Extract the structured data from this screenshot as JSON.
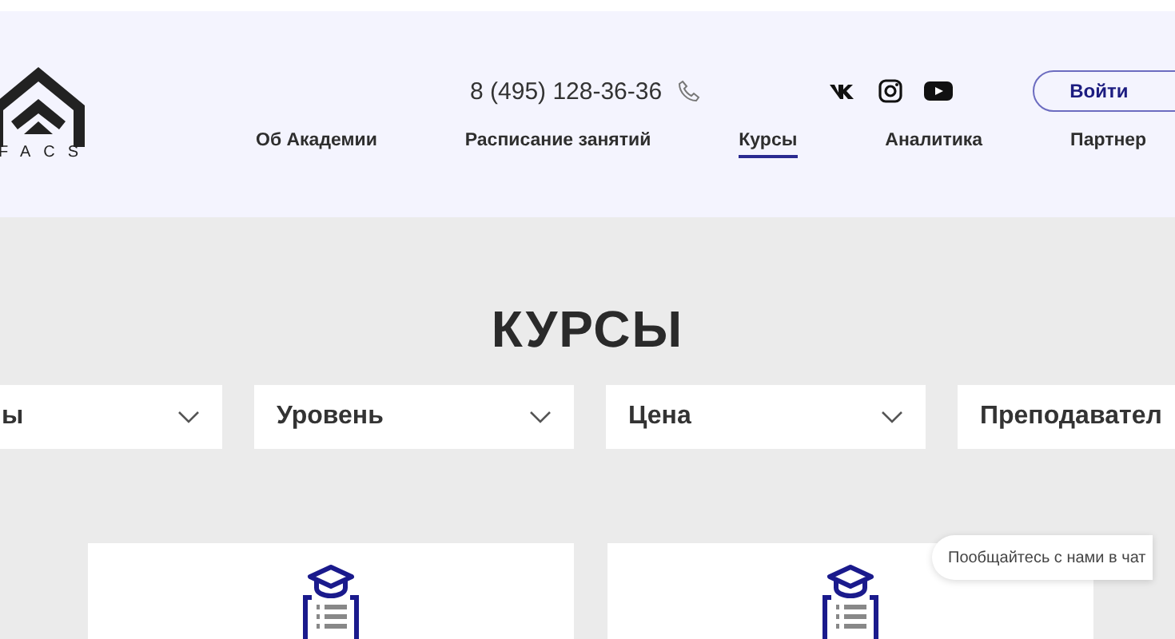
{
  "header": {
    "logo_text": "FACS",
    "phone": "8 (495) 128-36-36",
    "login_button": "Войти",
    "nav": [
      {
        "label": "Об Академии",
        "selected": false
      },
      {
        "label": "Расписание занятий",
        "selected": false
      },
      {
        "label": "Курсы",
        "selected": true
      },
      {
        "label": "Аналитика",
        "selected": false
      },
      {
        "label": "Партнер",
        "selected": false
      }
    ]
  },
  "page_title": "КУРСЫ",
  "filters": [
    {
      "label": "ы"
    },
    {
      "label": "Уровень"
    },
    {
      "label": "Цена"
    },
    {
      "label": "Преподавател"
    }
  ],
  "cards": [
    {
      "kind": "course"
    },
    {
      "kind": "course"
    }
  ],
  "chat_bubble": "Пообщайтесь с нами в чат"
}
